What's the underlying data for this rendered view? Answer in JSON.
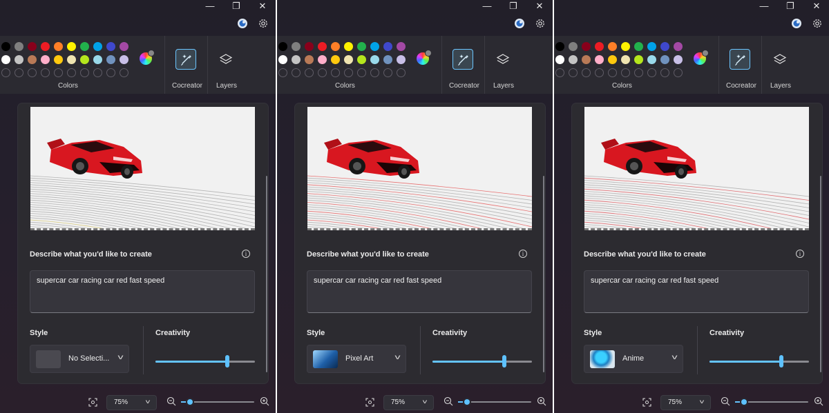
{
  "window": {
    "minimize": "—",
    "restore": "❐",
    "close": "✕"
  },
  "toolbar": {
    "colors_label": "Colors",
    "cocreator_label": "Cocreator",
    "layers_label": "Layers",
    "palette_row1": [
      "#000000",
      "#7f7f7f",
      "#88001b",
      "#ec1c24",
      "#ff7f27",
      "#fff200",
      "#22b14c",
      "#00a2e8",
      "#3f48cc",
      "#a349a4"
    ],
    "palette_row2": [
      "#ffffff",
      "#c3c3c3",
      "#b97a57",
      "#ffaec9",
      "#ffc90e",
      "#efe4b0",
      "#b5e61d",
      "#99d9ea",
      "#7092be",
      "#c8bfe7"
    ]
  },
  "cocreator": {
    "describe_label": "Describe what you'd like to create",
    "prompt": "supercar car racing car red fast speed",
    "style_label": "Style",
    "creativity_label": "Creativity",
    "creativity_value": 0.72
  },
  "panes": [
    {
      "style_value": "No Selecti...",
      "style_key": "none"
    },
    {
      "style_value": "Pixel Art",
      "style_key": "pixel"
    },
    {
      "style_value": "Anime",
      "style_key": "anime"
    }
  ],
  "zoom": {
    "value": "75%",
    "level": 0.12
  }
}
